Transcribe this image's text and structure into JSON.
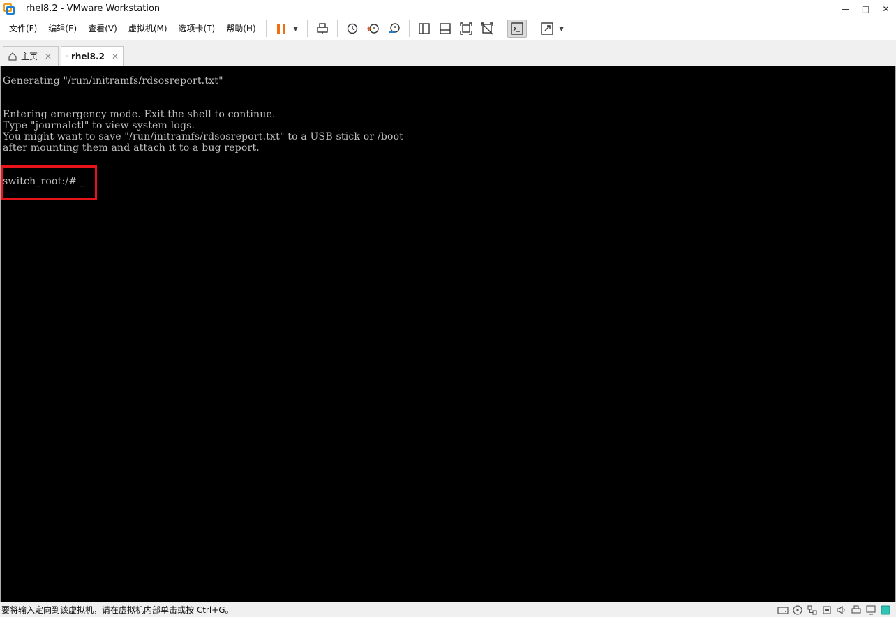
{
  "window": {
    "title": "rhel8.2 - VMware Workstation",
    "minimize": "—",
    "maximize": "□",
    "close": "✕"
  },
  "menu": {
    "file": "文件(F)",
    "edit": "编辑(E)",
    "view": "查看(V)",
    "vm": "虚拟机(M)",
    "tabs": "选项卡(T)",
    "help": "帮助(H)"
  },
  "tabs": [
    {
      "label": "主页",
      "close": "✕"
    },
    {
      "label": "rhel8.2",
      "close": "✕"
    }
  ],
  "console": {
    "lines": [
      "Generating \"/run/initramfs/rdsosreport.txt\"",
      "Entering emergency mode. Exit the shell to continue.",
      "Type \"journalctl\" to view system logs.",
      "You might want to save \"/run/initramfs/rdsosreport.txt\" to a USB stick or /boot",
      "after mounting them and attach it to a bug report.",
      "switch_root:/# _"
    ]
  },
  "status": {
    "text": "要将输入定向到该虚拟机，请在虚拟机内部单击或按 Ctrl+G。"
  },
  "colors": {
    "highlight": "#e8141b",
    "console_bg": "#000000",
    "console_fg": "#c0c0c0",
    "pause_orange": "#f07010"
  }
}
